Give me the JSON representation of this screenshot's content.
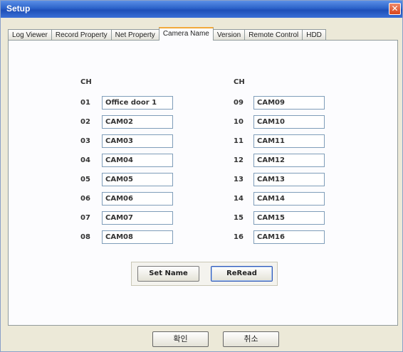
{
  "window": {
    "title": "Setup",
    "close_icon": "close-icon"
  },
  "tabs": [
    {
      "label": "Log Viewer"
    },
    {
      "label": "Record Property"
    },
    {
      "label": "Net Property"
    },
    {
      "label": "Camera Name",
      "active": true
    },
    {
      "label": "Version"
    },
    {
      "label": "Remote Control"
    },
    {
      "label": "HDD"
    }
  ],
  "camera_name": {
    "left_header": "CH",
    "right_header": "CH",
    "channels": [
      {
        "ch": "01",
        "name": "Office door 1"
      },
      {
        "ch": "02",
        "name": "CAM02"
      },
      {
        "ch": "03",
        "name": "CAM03"
      },
      {
        "ch": "04",
        "name": "CAM04"
      },
      {
        "ch": "05",
        "name": "CAM05"
      },
      {
        "ch": "06",
        "name": "CAM06"
      },
      {
        "ch": "07",
        "name": "CAM07"
      },
      {
        "ch": "08",
        "name": "CAM08"
      },
      {
        "ch": "09",
        "name": "CAM09"
      },
      {
        "ch": "10",
        "name": "CAM10"
      },
      {
        "ch": "11",
        "name": "CAM11"
      },
      {
        "ch": "12",
        "name": "CAM12"
      },
      {
        "ch": "13",
        "name": "CAM13"
      },
      {
        "ch": "14",
        "name": "CAM14"
      },
      {
        "ch": "15",
        "name": "CAM15"
      },
      {
        "ch": "16",
        "name": "CAM16"
      }
    ],
    "set_name_label": "Set Name",
    "reread_label": "ReRead"
  },
  "footer": {
    "ok_label": "확인",
    "cancel_label": "취소"
  }
}
